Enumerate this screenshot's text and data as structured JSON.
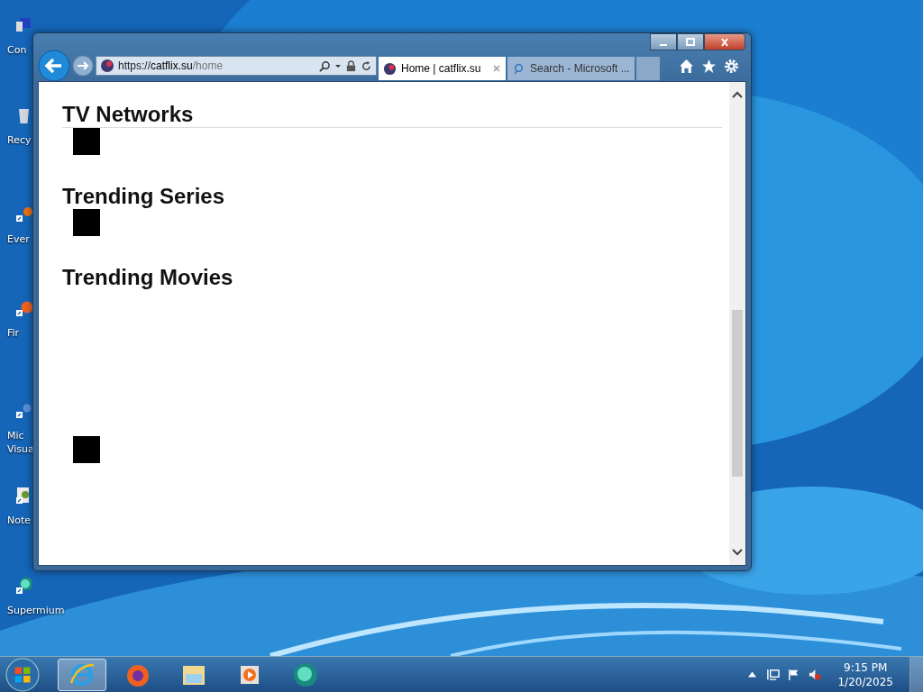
{
  "desktop": {
    "icons": [
      {
        "label": "Con",
        "kind": "computer"
      },
      {
        "label": "Recy",
        "kind": "recycle"
      },
      {
        "label": "Ever",
        "kind": "evernote"
      },
      {
        "label": "Fir",
        "kind": "firefox"
      },
      {
        "label": "Mic\nVisua",
        "kind": "studio"
      },
      {
        "label": "Note",
        "kind": "notepad"
      },
      {
        "label": "Supermium",
        "kind": "supermium"
      }
    ]
  },
  "browser": {
    "address": {
      "scheme": "https://",
      "host": "catflix.su",
      "path": "/home"
    },
    "tabs": [
      {
        "title": "Home | catflix.su",
        "kind": "site",
        "selected": true
      },
      {
        "title": "Search - Microsoft ...",
        "kind": "search",
        "selected": false
      }
    ],
    "page": {
      "sections": [
        {
          "heading": "TV Networks",
          "broken_image": true
        },
        {
          "heading": "Trending Series",
          "broken_image": true
        },
        {
          "heading": "Trending Movies",
          "broken_image": true
        }
      ]
    }
  },
  "taskbar": {
    "items": [
      {
        "kind": "ie",
        "selected": true
      },
      {
        "kind": "firefox",
        "selected": false
      },
      {
        "kind": "explorer",
        "selected": false
      },
      {
        "kind": "media",
        "selected": false
      },
      {
        "kind": "supermium",
        "selected": false
      }
    ],
    "clock": {
      "time": "9:15 PM",
      "date": "1/20/2025"
    }
  }
}
